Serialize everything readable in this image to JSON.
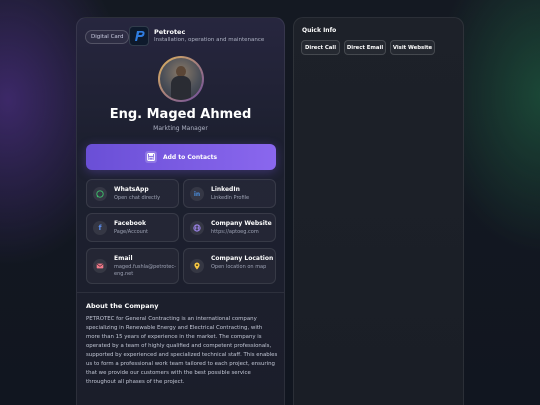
{
  "card": {
    "tag": "Digital Card",
    "brand": {
      "name": "Petrotec",
      "tagline": "Installation, operation and maintenance"
    },
    "name": "Eng. Maged Ahmed",
    "role": "Markting Manager",
    "add_contact": "Add to Contacts",
    "tiles": [
      {
        "title": "WhatsApp",
        "subtitle": "Open chat directly",
        "icon": "whatsapp-icon",
        "color": "#3ec46d"
      },
      {
        "title": "LinkedIn",
        "subtitle": "LinkedIn Profile",
        "icon": "linkedin-icon",
        "color": "#4a8fe0"
      },
      {
        "title": "Facebook",
        "subtitle": "Page/Account",
        "icon": "facebook-icon",
        "color": "#5b8ef0"
      },
      {
        "title": "Company Website",
        "subtitle": "https://aptoeg.com",
        "icon": "globe-icon",
        "color": "#a78bfa"
      },
      {
        "title": "Email",
        "subtitle": "maged.fushla@petrotec-eng.net",
        "icon": "mail-icon",
        "color": "#f07a8a"
      },
      {
        "title": "Company Location",
        "subtitle": "Open location on map",
        "icon": "location-pin-icon",
        "color": "#f5c542"
      }
    ],
    "about": {
      "title": "About the Company",
      "text": "PETROTEC for General Contracting is an international company specializing in Renewable Energy and Electrical Contracting, with more than 15 years of experience in the market. The company is operated by a team of highly qualified and competent professionals, supported by experienced and specialized technical staff. This enables us to form a professional work team tailored to each project, ensuring that we provide our customers with the best possible service throughout all phases of the project."
    }
  },
  "quick_info": {
    "title": "Quick Info",
    "buttons": [
      "Direct Call",
      "Direct Email",
      "Visit Website"
    ]
  },
  "colors": {
    "accent": "#7b5ce6",
    "accent_end": "#8a67ee"
  }
}
